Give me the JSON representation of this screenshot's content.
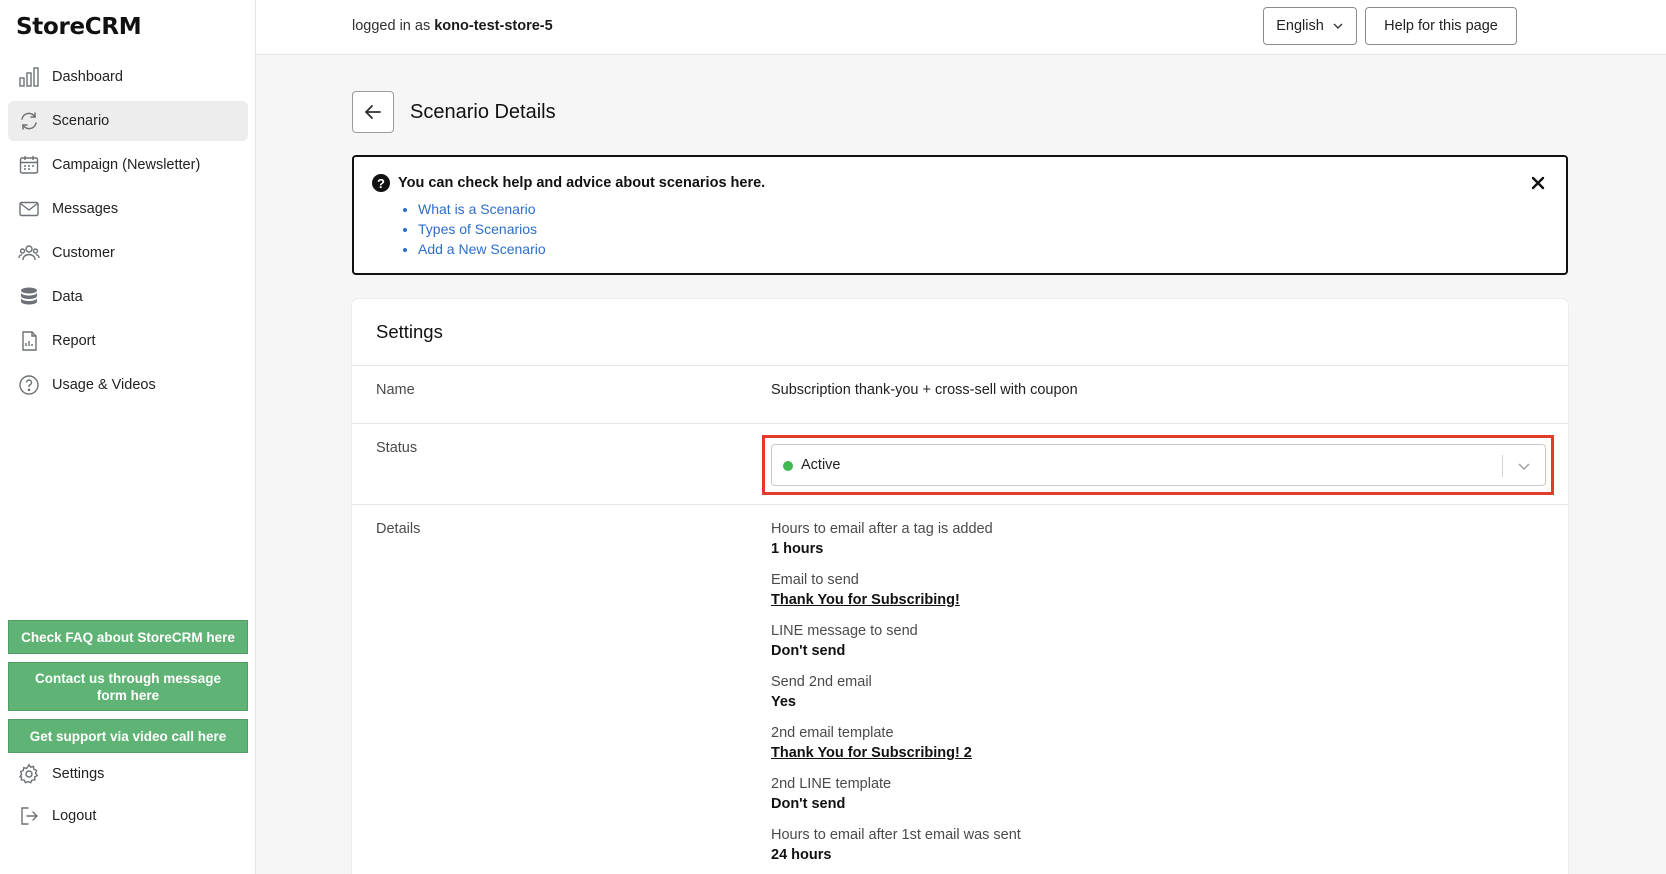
{
  "app": {
    "name": "StoreCRM"
  },
  "sidebar": {
    "items": [
      {
        "label": "Dashboard",
        "icon": "bar-chart-icon"
      },
      {
        "label": "Scenario",
        "icon": "refresh-icon",
        "active": true
      },
      {
        "label": "Campaign (Newsletter)",
        "icon": "calendar-icon"
      },
      {
        "label": "Messages",
        "icon": "mail-icon"
      },
      {
        "label": "Customer",
        "icon": "users-icon"
      },
      {
        "label": "Data",
        "icon": "database-icon"
      },
      {
        "label": "Report",
        "icon": "report-icon"
      },
      {
        "label": "Usage & Videos",
        "icon": "help-circle-icon"
      }
    ],
    "support_buttons": [
      "Check FAQ about StoreCRM here",
      "Contact us through message form here",
      "Get support via video call here"
    ],
    "settings_label": "Settings",
    "logout_label": "Logout",
    "accent_color": "#5fb375"
  },
  "topbar": {
    "login_prefix": "logged in as",
    "store_name": "kono-test-store-5",
    "language": "English",
    "help_button": "Help for this page"
  },
  "page": {
    "title": "Scenario Details"
  },
  "help_box": {
    "heading": "You can check help and advice about scenarios here.",
    "links": [
      "What is a Scenario",
      "Types of Scenarios",
      "Add a New Scenario"
    ]
  },
  "settings": {
    "title": "Settings",
    "name_label": "Name",
    "name_value": "Subscription thank-you + cross-sell with coupon",
    "status_label": "Status",
    "status_value": "Active",
    "status_color": "#3fb950",
    "highlight_color": "#e23b2b",
    "details_label": "Details",
    "details": [
      {
        "label": "Hours to email after a tag is added",
        "value": "1 hours",
        "link": false
      },
      {
        "label": "Email to send",
        "value": "Thank You for Subscribing!",
        "link": true
      },
      {
        "label": "LINE message to send",
        "value": "Don't send",
        "link": false
      },
      {
        "label": "Send 2nd email",
        "value": "Yes",
        "link": false
      },
      {
        "label": "2nd email template",
        "value": "Thank You for Subscribing! 2",
        "link": true
      },
      {
        "label": "2nd LINE template",
        "value": "Don't send",
        "link": false
      },
      {
        "label": "Hours to email after 1st email was sent",
        "value": "24 hours",
        "link": false
      }
    ]
  }
}
